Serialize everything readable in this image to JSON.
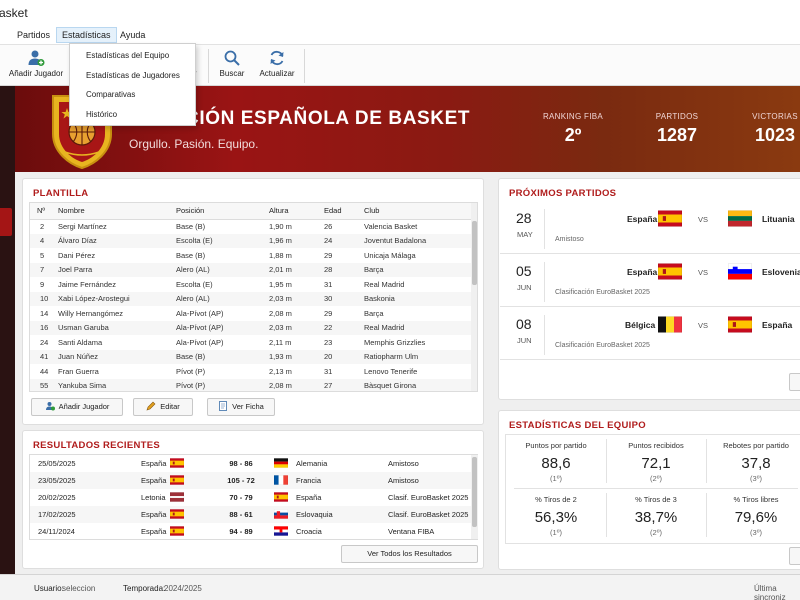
{
  "window": {
    "title": "asket"
  },
  "menu": {
    "items": [
      "Partidos",
      "Estadísticas",
      "Ayuda"
    ],
    "dropdown": [
      "Estadísticas del Equipo",
      "Estadísticas de Jugadores",
      "Comparativas",
      "Histórico"
    ]
  },
  "toolbar": {
    "add_player": "Añadir Jugador",
    "partial_label": "ar",
    "search": "Buscar",
    "refresh": "Actualizar"
  },
  "banner": {
    "title": "CIÓN ESPAÑOLA DE BASKET",
    "subtitle": "Orgullo. Pasión. Equipo.",
    "stats": [
      {
        "label": "RANKING FIBA",
        "value": "2º"
      },
      {
        "label": "PARTIDOS",
        "value": "1287"
      },
      {
        "label": "VICTORIAS",
        "value": "1023"
      }
    ]
  },
  "roster": {
    "title": "PLANTILLA",
    "headers": [
      "Nº",
      "Nombre",
      "Posición",
      "Altura",
      "Edad",
      "Club"
    ],
    "rows": [
      [
        "2",
        "Sergi Martínez",
        "Base (B)",
        "1,90 m",
        "26",
        "Valencia Basket"
      ],
      [
        "4",
        "Álvaro Díaz",
        "Escolta (E)",
        "1,96 m",
        "24",
        "Joventut Badalona"
      ],
      [
        "5",
        "Dani Pérez",
        "Base (B)",
        "1,88 m",
        "29",
        "Unicaja Málaga"
      ],
      [
        "7",
        "Joel Parra",
        "Alero (AL)",
        "2,01 m",
        "28",
        "Barça"
      ],
      [
        "9",
        "Jaime Fernández",
        "Escolta (E)",
        "1,95 m",
        "31",
        "Real Madrid"
      ],
      [
        "10",
        "Xabi López-Arostegui",
        "Alero (AL)",
        "2,03 m",
        "30",
        "Baskonia"
      ],
      [
        "14",
        "Willy Hernangómez",
        "Ala-Pívot (AP)",
        "2,08 m",
        "29",
        "Barça"
      ],
      [
        "16",
        "Usman Garuba",
        "Ala-Pívot (AP)",
        "2,03 m",
        "22",
        "Real Madrid"
      ],
      [
        "24",
        "Santi Aldama",
        "Ala-Pívot (AP)",
        "2,11 m",
        "23",
        "Memphis Grizzlies"
      ],
      [
        "41",
        "Juan Núñez",
        "Base (B)",
        "1,93 m",
        "20",
        "Ratiopharm Ulm"
      ],
      [
        "44",
        "Fran Guerra",
        "Pívot (P)",
        "2,13 m",
        "31",
        "Lenovo Tenerife"
      ],
      [
        "55",
        "Yankuba Sima",
        "Pívot (P)",
        "2,08 m",
        "27",
        "Bàsquet Girona"
      ]
    ],
    "buttons": {
      "add": "Añadir Jugador",
      "edit": "Editar",
      "view": "Ver Ficha"
    }
  },
  "results": {
    "title": "RESULTADOS RECIENTES",
    "rows": [
      {
        "date": "25/05/2025",
        "home": "España",
        "home_flag": "es",
        "score": "98 - 86",
        "away": "Alemania",
        "away_flag": "de",
        "comp": "Amistoso"
      },
      {
        "date": "23/05/2025",
        "home": "España",
        "home_flag": "es",
        "score": "105 - 72",
        "away": "Francia",
        "away_flag": "fr",
        "comp": "Amistoso"
      },
      {
        "date": "20/02/2025",
        "home": "Letonia",
        "home_flag": "lv",
        "score": "70 - 79",
        "away": "España",
        "away_flag": "es",
        "comp": "Clasif. EuroBasket 2025"
      },
      {
        "date": "17/02/2025",
        "home": "España",
        "home_flag": "es",
        "score": "88 - 61",
        "away": "Eslovaquia",
        "away_flag": "sk",
        "comp": "Clasif. EuroBasket 2025"
      },
      {
        "date": "24/11/2024",
        "home": "España",
        "home_flag": "es",
        "score": "94 - 89",
        "away": "Croacia",
        "away_flag": "hr",
        "comp": "Ventana FIBA"
      }
    ],
    "view_all": "Ver Todos los Resultados"
  },
  "upcoming": {
    "title": "PRÓXIMOS PARTIDOS",
    "vs": "VS",
    "matches": [
      {
        "day": "28",
        "month": "MAY",
        "home": "España",
        "home_flag": "es",
        "away": "Lituania",
        "away_flag": "lt",
        "comp": "Amistoso"
      },
      {
        "day": "05",
        "month": "JUN",
        "home": "España",
        "home_flag": "es",
        "away": "Eslovenia",
        "away_flag": "si",
        "comp": "Clasificación EuroBasket 2025"
      },
      {
        "day": "08",
        "month": "JUN",
        "home": "Bélgica",
        "home_flag": "be",
        "away": "España",
        "away_flag": "es",
        "comp": "Clasificación EuroBasket 2025"
      }
    ]
  },
  "team_stats": {
    "title": "ESTADÍSTICAS DEL EQUIPO",
    "cells": [
      {
        "label": "Puntos por partido",
        "value": "88,6",
        "rank": "(1º)"
      },
      {
        "label": "Puntos recibidos",
        "value": "72,1",
        "rank": "(2º)"
      },
      {
        "label": "Rebotes por partido",
        "value": "37,8",
        "rank": "(3º)"
      },
      {
        "label": "% Tiros de 2",
        "value": "56,3%",
        "rank": "(1º)"
      },
      {
        "label": "% Tiros de 3",
        "value": "38,7%",
        "rank": "(2º)"
      },
      {
        "label": "% Tiros libres",
        "value": "79,6%",
        "rank": "(3º)"
      }
    ]
  },
  "status": {
    "user_label": "Usuario:",
    "user": "seleccion",
    "season_label": "Temporada:",
    "season": "2024/2025",
    "last_sync": "Última sincroniz"
  },
  "colors": {
    "accent": "#b01c1c",
    "banner": "#8a1414",
    "sidebar": "#2a1212"
  }
}
